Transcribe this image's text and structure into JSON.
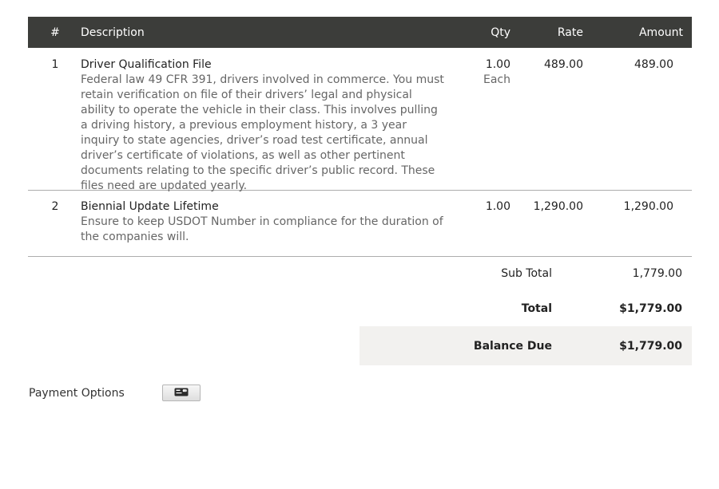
{
  "table": {
    "headers": {
      "num": "#",
      "description": "Description",
      "qty": "Qty",
      "rate": "Rate",
      "amount": "Amount"
    },
    "items": [
      {
        "num": "1",
        "title": "Driver Qualification File",
        "description": "Federal law 49 CFR 391, drivers involved in commerce. You must retain verification on file of their drivers’ legal and physical ability to operate the vehicle in their class. This involves pulling a driving history, a previous employment history, a 3 year inquiry to state agencies, driver’s road test certificate, annual driver’s certificate of violations, as well as other pertinent documents relating to the specific driver’s public record. These files need are updated yearly.",
        "qty": "1.00",
        "unit": "Each",
        "rate": "489.00",
        "amount": "489.00"
      },
      {
        "num": "2",
        "title": "Biennial Update Lifetime",
        "description": "Ensure to keep USDOT Number in compliance for the duration of the companies will.",
        "qty": "1.00",
        "rate": "1,290.00",
        "amount": "1,290.00"
      }
    ]
  },
  "totals": {
    "subtotal_label": "Sub Total",
    "subtotal_value": "1,779.00",
    "total_label": "Total",
    "total_value": "$1,779.00",
    "balance_label": "Balance Due",
    "balance_value": "$1,779.00"
  },
  "payment": {
    "label": "Payment Options",
    "icon": "credit-card-icon"
  }
}
